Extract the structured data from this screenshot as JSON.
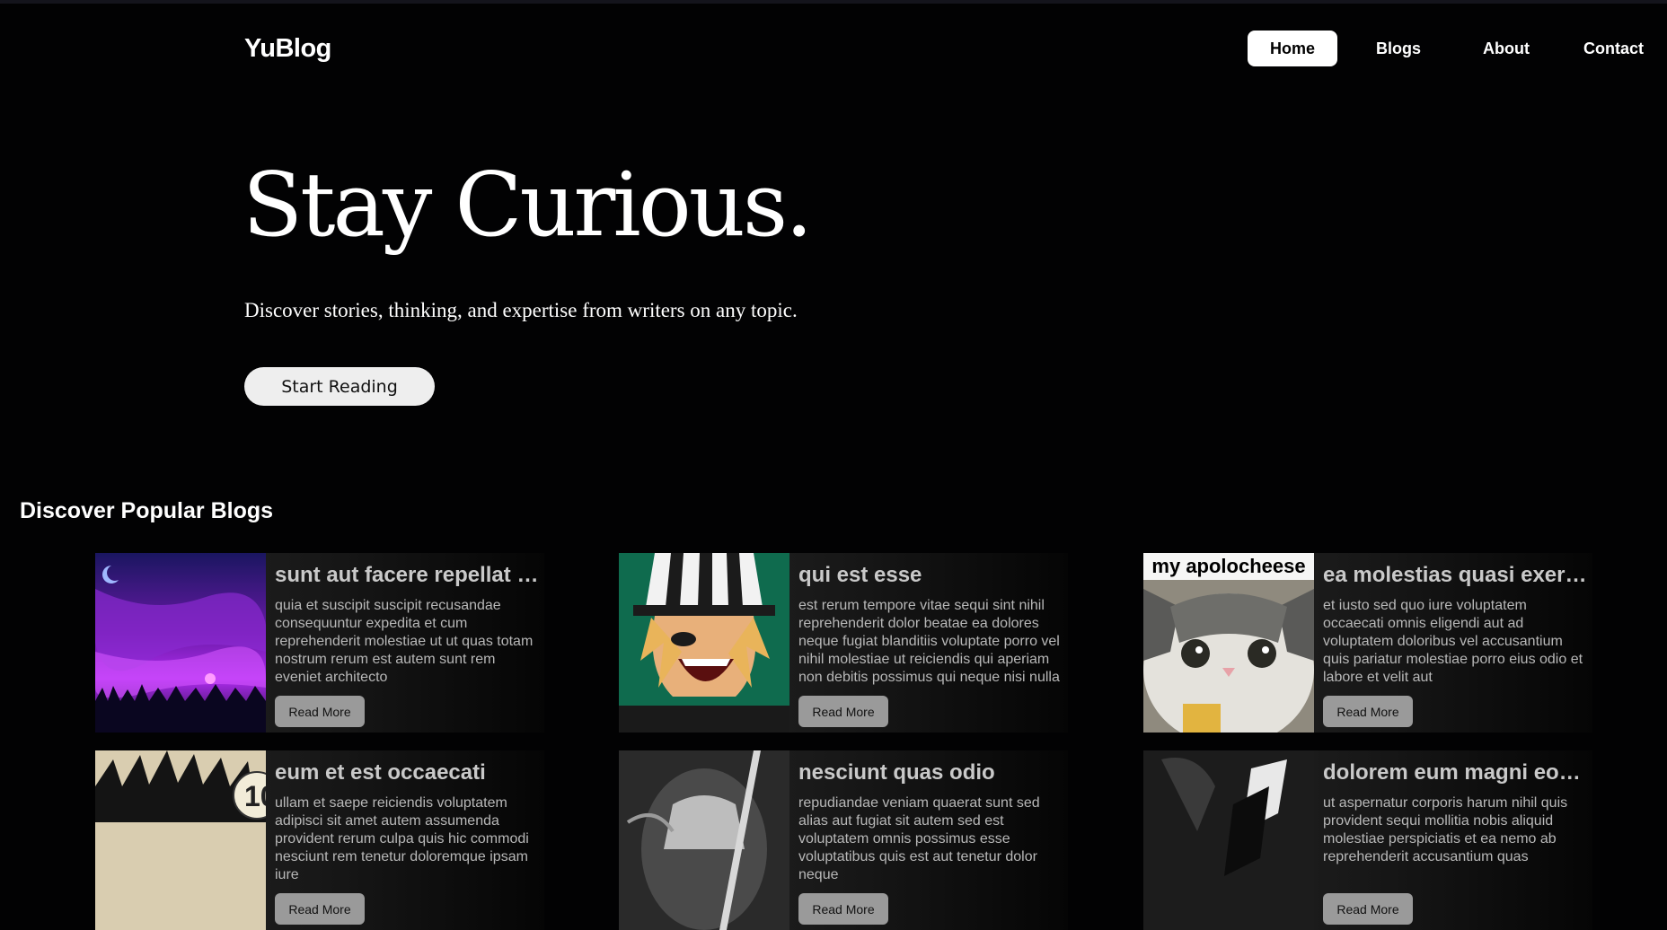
{
  "header": {
    "brand": "YuBlog",
    "nav": [
      {
        "label": "Home",
        "active": true
      },
      {
        "label": "Blogs",
        "active": false
      },
      {
        "label": "About",
        "active": false
      },
      {
        "label": "Contact",
        "active": false
      }
    ]
  },
  "hero": {
    "title": "Stay Curious.",
    "subtitle": "Discover stories, thinking, and expertise from writers on any topic.",
    "cta_label": "Start Reading"
  },
  "popular": {
    "title": "Discover Popular Blogs",
    "read_more_label": "Read More",
    "posts": [
      {
        "title": "sunt aut facere repellat provident occaecati excepturi optio reprehenderit",
        "body": "quia et suscipit suscipit recusandae consequuntur expedita et cum reprehenderit molestiae ut ut quas totam nostrum rerum est autem sunt rem eveniet architecto",
        "image": "purple-night-sky-image"
      },
      {
        "title": "qui est esse",
        "body": "est rerum tempore vitae sequi sint nihil reprehenderit dolor beatae ea dolores neque fugiat blanditiis voluptate porro vel nihil molestiae ut reiciendis qui aperiam non debitis possimus qui neque nisi nulla",
        "image": "anime-character-striped-hat-image"
      },
      {
        "title": "ea molestias quasi exercitationem repellat qui ipsa sit aut",
        "body": "et iusto sed quo iure voluptatem occaecati omnis eligendi aut ad voluptatem doloribus vel accusantium quis pariatur molestiae porro eius odio et labore et velit aut",
        "image": "cat-meme-image",
        "image_caption": "my apolocheese"
      },
      {
        "title": "eum et est occaecati",
        "body": "ullam et saepe reiciendis voluptatem adipisci sit amet autem assumenda provident rerum culpa quis hic commodi nesciunt rem tenetur doloremque ipsam iure",
        "image": "anime-spiky-hair-image"
      },
      {
        "title": "nesciunt quas odio",
        "body": "repudiandae veniam quaerat sunt sed alias aut fugiat sit autem sed est voluptatem omnis possimus esse voluptatibus quis est aut tenetur dolor neque",
        "image": "grayscale-wizard-image"
      },
      {
        "title": "dolorem eum magni eos aperiam quia",
        "body": "ut aspernatur corporis harum nihil quis provident sequi mollitia nobis aliquid molestiae perspiciatis et ea nemo ab reprehenderit accusantium quas",
        "image": "grayscale-dark-figure-image"
      }
    ]
  }
}
